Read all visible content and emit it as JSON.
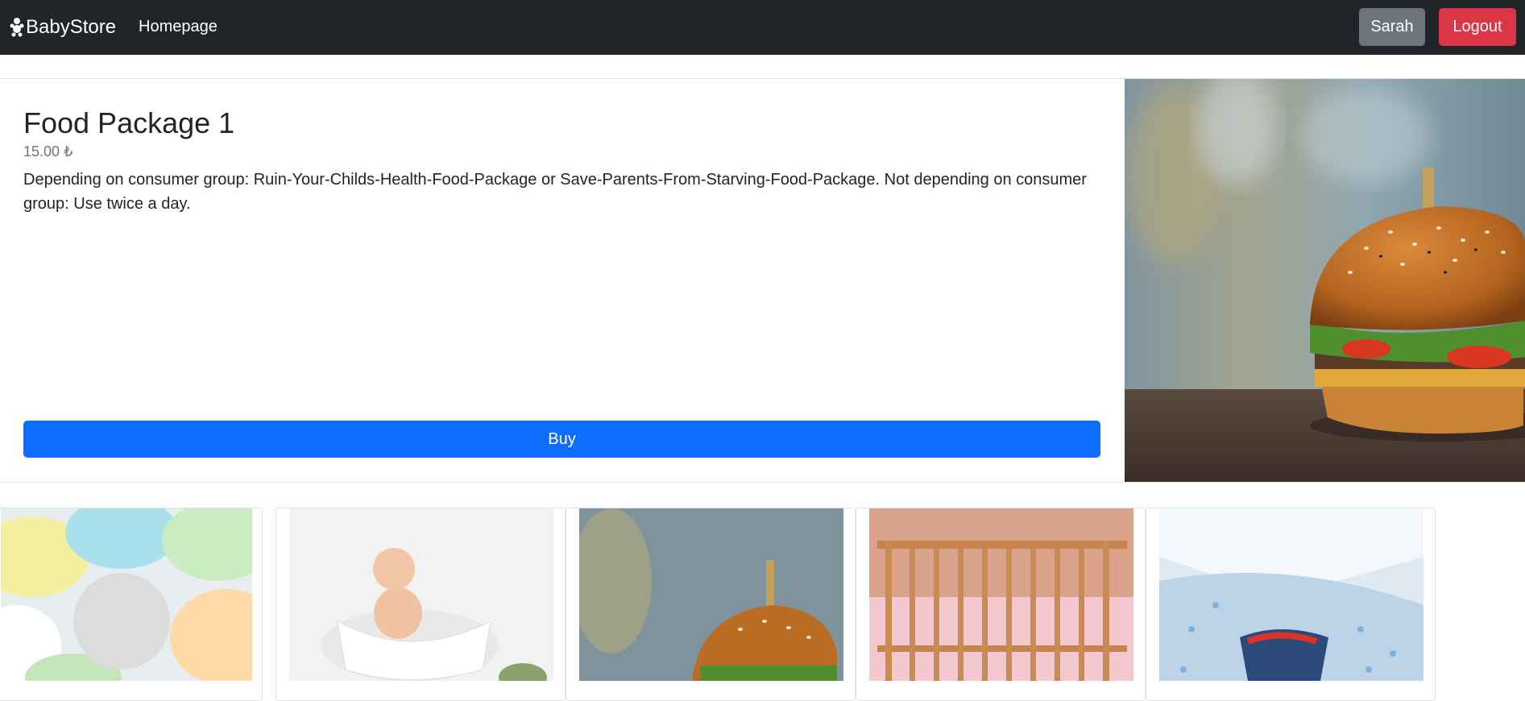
{
  "navbar": {
    "brand": "BabyStore",
    "brand_icon": "baby-icon",
    "homepage_link": "Homepage",
    "user_button": "Sarah",
    "logout_button": "Logout"
  },
  "product": {
    "title": "Food Package 1",
    "price": "15.00 ₺",
    "description": "Depending on consumer group: Ruin-Your-Childs-Health-Food-Package or Save-Parents-From-Starving-Food-Package. Not depending on consumer group: Use twice a day.",
    "buy_button": "Buy",
    "image": "burger-image"
  },
  "thumbnails": [
    {
      "image": "cloth-diapers-image"
    },
    {
      "image": "baby-in-bathtub-image"
    },
    {
      "image": "burger-image"
    },
    {
      "image": "wooden-crib-image"
    },
    {
      "image": "baby-clothes-image"
    }
  ],
  "colors": {
    "navbar_bg": "#212529",
    "primary": "#0d6efd",
    "secondary": "#6c757d",
    "danger": "#dc3545"
  }
}
